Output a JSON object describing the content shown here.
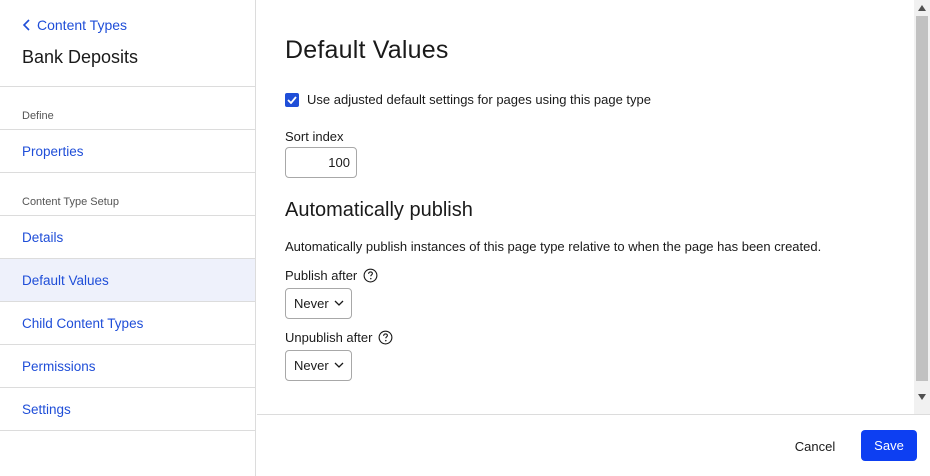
{
  "sidebar": {
    "back_label": "Content Types",
    "title": "Bank Deposits",
    "group_define": "Define",
    "group_setup": "Content Type Setup",
    "items": [
      {
        "label": "Properties"
      },
      {
        "label": "Details"
      },
      {
        "label": "Default Values"
      },
      {
        "label": "Child Content Types"
      },
      {
        "label": "Permissions"
      },
      {
        "label": "Settings"
      }
    ],
    "active_item": "Default Values"
  },
  "main": {
    "title": "Default Values",
    "use_defaults_label": "Use adjusted default settings for pages using this page type",
    "use_defaults_checked": true,
    "sort_index_label": "Sort index",
    "sort_index_value": "100",
    "publish_section_title": "Automatically publish",
    "publish_description": "Automatically publish instances of this page type relative to when the page has been created.",
    "publish_after_label": "Publish after",
    "publish_after_value": "Never",
    "unpublish_after_label": "Unpublish after",
    "unpublish_after_value": "Never"
  },
  "footer": {
    "cancel_label": "Cancel",
    "save_label": "Save"
  },
  "colors": {
    "accent": "#1f4ed8",
    "primary_button": "#0d3ff2",
    "active_item_bg": "#eef1fb"
  }
}
